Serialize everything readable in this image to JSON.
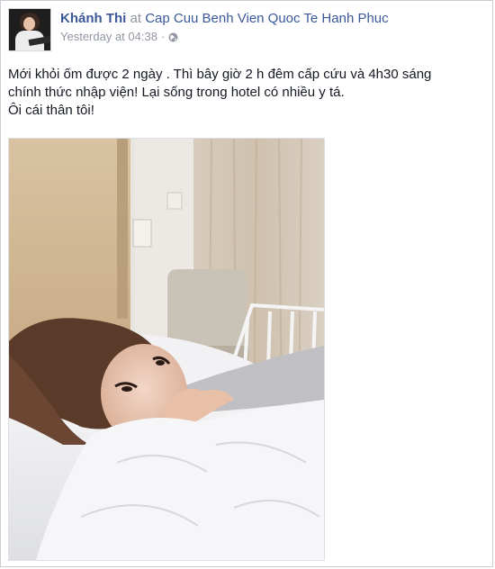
{
  "post": {
    "author": "Khánh Thi",
    "at_text": "at",
    "location": "Cap Cuu Benh Vien Quoc Te Hanh Phuc",
    "timestamp": "Yesterday at 04:38",
    "separator": "·",
    "privacy_icon": "globe-icon",
    "body_lines": [
      "Mới khỏi ốm được 2 ngày . Thì bây giờ 2 h đêm cấp cứu và 4h30 sáng",
      "chính thức nhập viện! Lại sống trong hotel có nhiều y tá.",
      "Ôi cái thân tôi!"
    ]
  },
  "colors": {
    "link": "#3b5998",
    "muted": "#9197a3",
    "text": "#141823"
  }
}
